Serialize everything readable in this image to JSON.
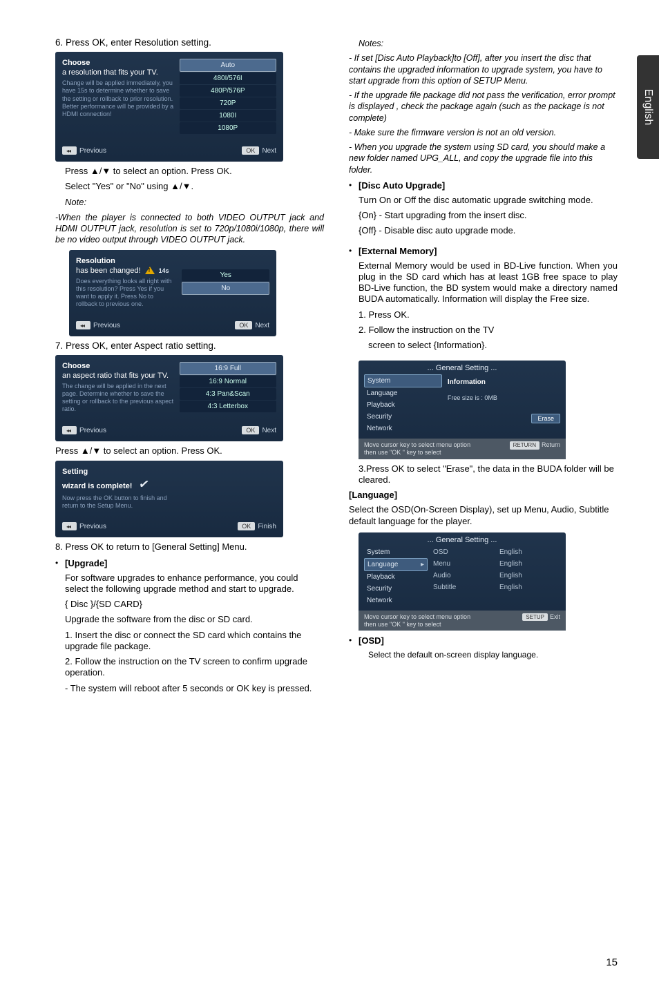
{
  "side_tab": "English",
  "page_number": "15",
  "left": {
    "step6": "6. Press OK, enter Resolution setting.",
    "choose_box": {
      "title": "Choose",
      "subtitle": "a resolution that fits your TV.",
      "desc": "Change will be applied immediately, you have 15s to determine whether to save the setting or rollback to prior resolution. Better performance will be provided by a HDMI connection!",
      "options": [
        "Auto",
        "480I/576I",
        "480P/576P",
        "720P",
        "1080I",
        "1080P"
      ],
      "prev_label": "Previous",
      "next_label": "Next",
      "ok_label": "OK"
    },
    "after_choose_1": "Press ▲/▼ to select an option. Press OK.",
    "after_choose_2": "Select \"Yes\" or \"No\" using ▲/▼.",
    "after_choose_note_label": "Note:",
    "after_choose_note": "-When the player is connected to both VIDEO OUTPUT jack and HDMI OUTPUT jack, resolution is set to 720p/1080i/1080p, there will be no video output through VIDEO OUTPUT jack.",
    "res_box": {
      "title": "Resolution",
      "subtitle": "has been changed!",
      "timer": "14s",
      "desc": "Does everything looks all right with this resolution? Press Yes if you want to apply it. Press No to rollback to previous one.",
      "yes": "Yes",
      "no": "No",
      "prev_label": "Previous",
      "next_label": "Next",
      "ok_label": "OK"
    },
    "step7": "7. Press OK, enter Aspect ratio setting.",
    "aspect_box": {
      "title": "Choose",
      "subtitle": "an aspect ratio that fits your TV.",
      "desc": "The change will be applied in the next page. Determine whether to save the setting or rollback to the previous aspect ratio.",
      "options": [
        "16:9 Full",
        "16:9 Normal",
        "4:3 Pan&Scan",
        "4:3 Letterbox"
      ],
      "prev_label": "Previous",
      "next_label": "Next",
      "ok_label": "OK"
    },
    "after_aspect": "Press ▲/▼ to select an option. Press OK.",
    "setting_box": {
      "title": "Setting",
      "subtitle": "wizard is complete!",
      "desc": "Now press the OK button to finish and return to the Setup Menu.",
      "prev_label": "Previous",
      "finish_label": "Finish",
      "ok_label": "OK"
    },
    "step8": "8. Press OK to return to [General Setting] Menu.",
    "upgrade_head": "[Upgrade]",
    "upgrade_para": "For software upgrades to enhance performance, you could select the following upgrade method and start to upgrade.",
    "disc_sd": "{ Disc }/{SD CARD}",
    "disc_sd_desc": "Upgrade the software from the disc or SD card.",
    "upg_1": "1. Insert the disc or connect the SD card which contains the upgrade file package.",
    "upg_2": "2. Follow the instruction on the TV screen to confirm upgrade operation.",
    "upg_3": "- The system will reboot after 5 seconds or OK key is pressed."
  },
  "right": {
    "notes_label": "Notes:",
    "note1": "- If set [Disc Auto Playback]to [Off], after you insert the disc that contains the upgraded information to upgrade system, you have to start upgrade from this option of SETUP Menu.",
    "note2": "- If the upgrade file package did not pass the verification, error prompt is displayed , check the package again (such as the package is not complete)",
    "note3": "- Make sure the firmware version is not an old version.",
    "note4": "- When you upgrade the system using SD card, you should make a new folder named UPG_ALL, and copy the upgrade file into this folder.",
    "dau_head": "[Disc Auto Upgrade]",
    "dau_1": "Turn On or Off the disc automatic upgrade switching mode.",
    "dau_on": "{On} - Start upgrading from the insert disc.",
    "dau_off": "{Off} - Disable disc auto upgrade mode.",
    "ext_head": "[External Memory]",
    "ext_para": "External Memory would be used in BD-Live function. When you plug in the SD card which has at least 1GB free space to play BD-Live function, the BD system would make a directory named BUDA automatically. Information will display the Free size.",
    "ext_1": "1. Press OK.",
    "ext_2": "2. Follow the instruction on the TV",
    "ext_2b": "screen to select {Information}.",
    "gs1": {
      "title": "... General Setting ...",
      "items": [
        "System",
        "Language",
        "Playback",
        "Security",
        "Network"
      ],
      "info": "Information",
      "free": "Free size is : 0MB",
      "erase": "Erase",
      "foot1": "Move cursor key to select menu option",
      "foot2": "then use \"OK \" key to select",
      "return_key": "RETURN",
      "return_txt": "Return"
    },
    "ext_3": "3.Press OK to select \"Erase\", the data in the BUDA folder will be cleared.",
    "lang_head": "[Language]",
    "lang_para": "Select the OSD(On-Screen Display), set up Menu, Audio, Subtitle default language for the player.",
    "gs2": {
      "title": "... General Setting ...",
      "left_items": [
        "System",
        "Language",
        "Playback",
        "Security",
        "Network"
      ],
      "mid_items": [
        "OSD",
        "Menu",
        "Audio",
        "Subtitle"
      ],
      "right_items": [
        "English",
        "English",
        "English",
        "English"
      ],
      "foot1": "Move cursor key to select menu option",
      "foot2": "then use \"OK \" key to select",
      "exit_key": "SETUP",
      "exit_txt": "Exit"
    },
    "osd_head": "[OSD]",
    "osd_desc": "Select the default on-screen display language."
  }
}
